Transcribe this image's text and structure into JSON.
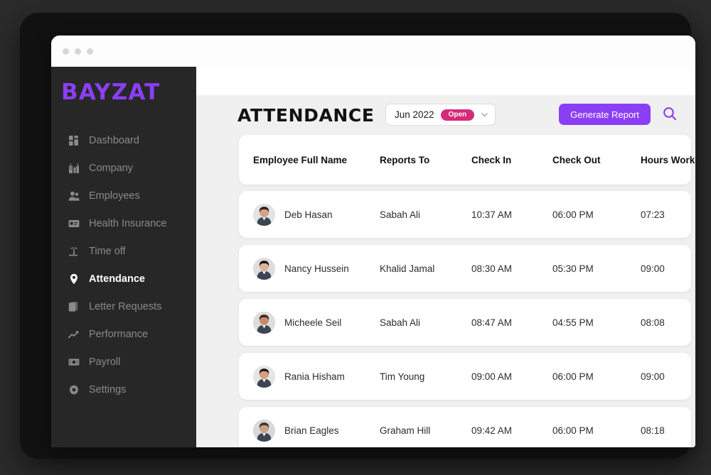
{
  "window": {
    "traffic_lights": 3
  },
  "sidebar": {
    "brand": "BAYZAT",
    "items": [
      {
        "label": "Dashboard",
        "icon": "dashboard-icon",
        "active": false
      },
      {
        "label": "Company",
        "icon": "buildings-icon",
        "active": false
      },
      {
        "label": "Employees",
        "icon": "people-icon",
        "active": false
      },
      {
        "label": "Health Insurance",
        "icon": "id-card-icon",
        "active": false
      },
      {
        "label": "Time off",
        "icon": "palm-tree-icon",
        "active": false
      },
      {
        "label": "Attendance",
        "icon": "location-pin-icon",
        "active": true
      },
      {
        "label": "Letter Requests",
        "icon": "documents-icon",
        "active": false
      },
      {
        "label": "Performance",
        "icon": "trend-up-icon",
        "active": false
      },
      {
        "label": "Payroll",
        "icon": "money-icon",
        "active": false
      },
      {
        "label": "Settings",
        "icon": "gear-icon",
        "active": false
      }
    ]
  },
  "header": {
    "title": "ATTENDANCE",
    "period": {
      "label": "Jun 2022",
      "badge": "Open",
      "chevron_icon": "chevron-down-icon"
    },
    "generate_report_label": "Generate Report",
    "search_icon": "search-icon"
  },
  "table": {
    "columns": [
      "Employee Full Name",
      "Reports To",
      "Check In",
      "Check Out",
      "Hours Worked"
    ],
    "rows": [
      {
        "name": "Deb Hasan",
        "reports_to": "Sabah Ali",
        "check_in": "10:37 AM",
        "check_out": "06:00 PM",
        "hours_worked": "07:23",
        "avatar": "avatar-photo"
      },
      {
        "name": "Nancy Hussein",
        "reports_to": "Khalid Jamal",
        "check_in": "08:30 AM",
        "check_out": "05:30 PM",
        "hours_worked": "09:00",
        "avatar": "avatar-photo"
      },
      {
        "name": "Micheele Seil",
        "reports_to": "Sabah Ali",
        "check_in": "08:47 AM",
        "check_out": "04:55 PM",
        "hours_worked": "08:08",
        "avatar": "avatar-photo"
      },
      {
        "name": "Rania Hisham",
        "reports_to": "Tim Young",
        "check_in": "09:00 AM",
        "check_out": "06:00 PM",
        "hours_worked": "09:00",
        "avatar": "avatar-photo"
      },
      {
        "name": "Brian Eagles",
        "reports_to": "Graham Hill",
        "check_in": "09:42 AM",
        "check_out": "06:00 PM",
        "hours_worked": "08:18",
        "avatar": "avatar-photo"
      }
    ]
  },
  "colors": {
    "brand_purple": "#8b3ff5",
    "badge_pink": "#d42a7c",
    "sidebar_bg": "#272727",
    "content_bg": "#f0f0f0"
  }
}
